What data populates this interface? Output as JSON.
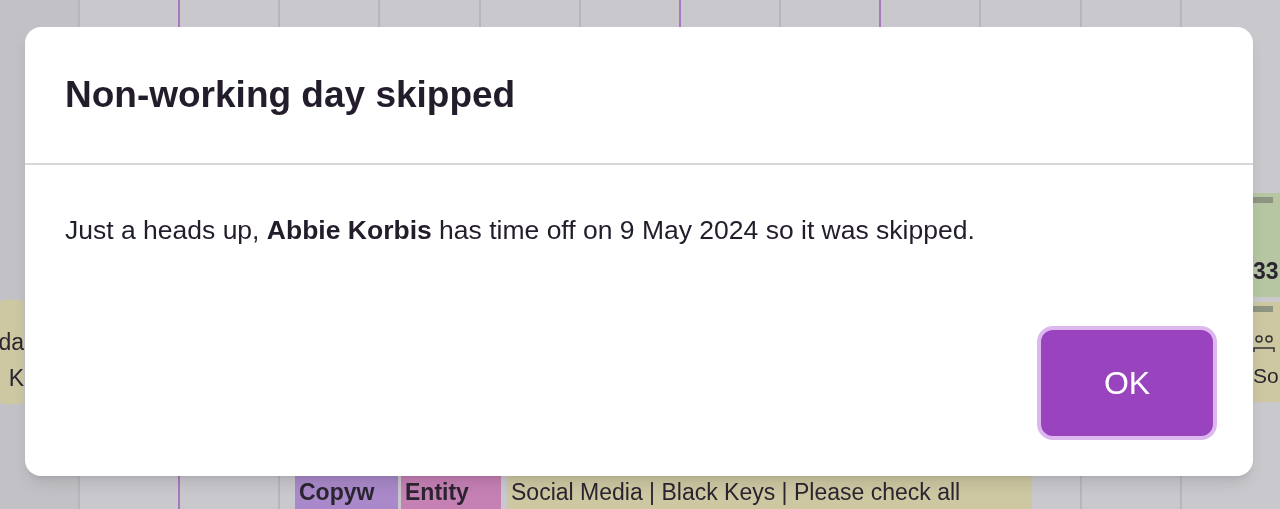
{
  "calendar": {
    "columns": [
      {
        "highlighted": false
      },
      {
        "highlighted": true
      },
      {
        "highlighted": false
      },
      {
        "highlighted": false
      },
      {
        "highlighted": false
      },
      {
        "highlighted": false
      },
      {
        "highlighted": true
      },
      {
        "highlighted": false
      },
      {
        "highlighted": true
      },
      {
        "highlighted": false
      },
      {
        "highlighted": false
      },
      {
        "highlighted": false
      }
    ],
    "events": [
      {
        "lines": [
          "da",
          "K"
        ],
        "color": "#cdc7a2",
        "kind": "plain"
      },
      {
        "lines": [
          "33"
        ],
        "color": "#b6c6a2",
        "kind": "plain"
      },
      {
        "lines": [
          "So"
        ],
        "color": "#cdc7a2",
        "kind": "assigned"
      },
      {
        "lines": [
          "Copyw"
        ],
        "color": "#a989c9",
        "kind": "plain"
      },
      {
        "lines": [
          "Entity"
        ],
        "color": "#c580b4",
        "kind": "plain"
      },
      {
        "lines": [
          "Social Media | Black Keys | Please check all"
        ],
        "color": "#cdc7a2",
        "kind": "plain"
      }
    ]
  },
  "dialog": {
    "title": "Non-working day skipped",
    "message": "Just a heads up, **Abbie Korbis** has time off on 9 May 2024 so it was skipped.",
    "buttons": [
      {
        "label": "OK",
        "focused": true
      }
    ]
  }
}
